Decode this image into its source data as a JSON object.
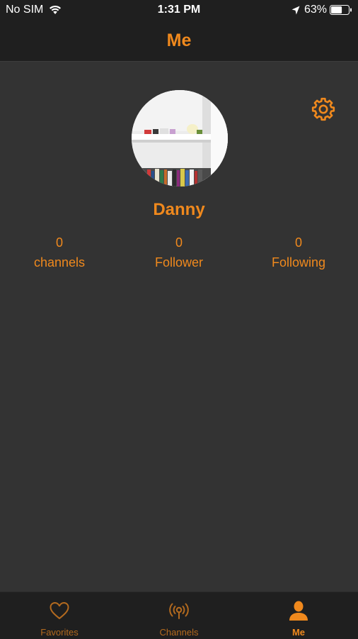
{
  "status_bar": {
    "carrier": "No SIM",
    "time": "1:31 PM",
    "battery": "63%",
    "battery_level": 0.63
  },
  "nav": {
    "title": "Me"
  },
  "profile": {
    "name": "Danny",
    "settings_icon": "gear-icon",
    "stats": [
      {
        "value": "0",
        "label": "channels"
      },
      {
        "value": "0",
        "label": "Follower"
      },
      {
        "value": "0",
        "label": "Following"
      }
    ]
  },
  "tabs": [
    {
      "label": "Favorites",
      "icon": "heart-icon",
      "active": false
    },
    {
      "label": "Channels",
      "icon": "broadcast-icon",
      "active": false
    },
    {
      "label": "Me",
      "icon": "person-icon",
      "active": true
    }
  ],
  "colors": {
    "accent": "#f0891d",
    "accent_dim": "#b36a1f",
    "background": "#333333",
    "bar_background": "#1f1f1f"
  }
}
